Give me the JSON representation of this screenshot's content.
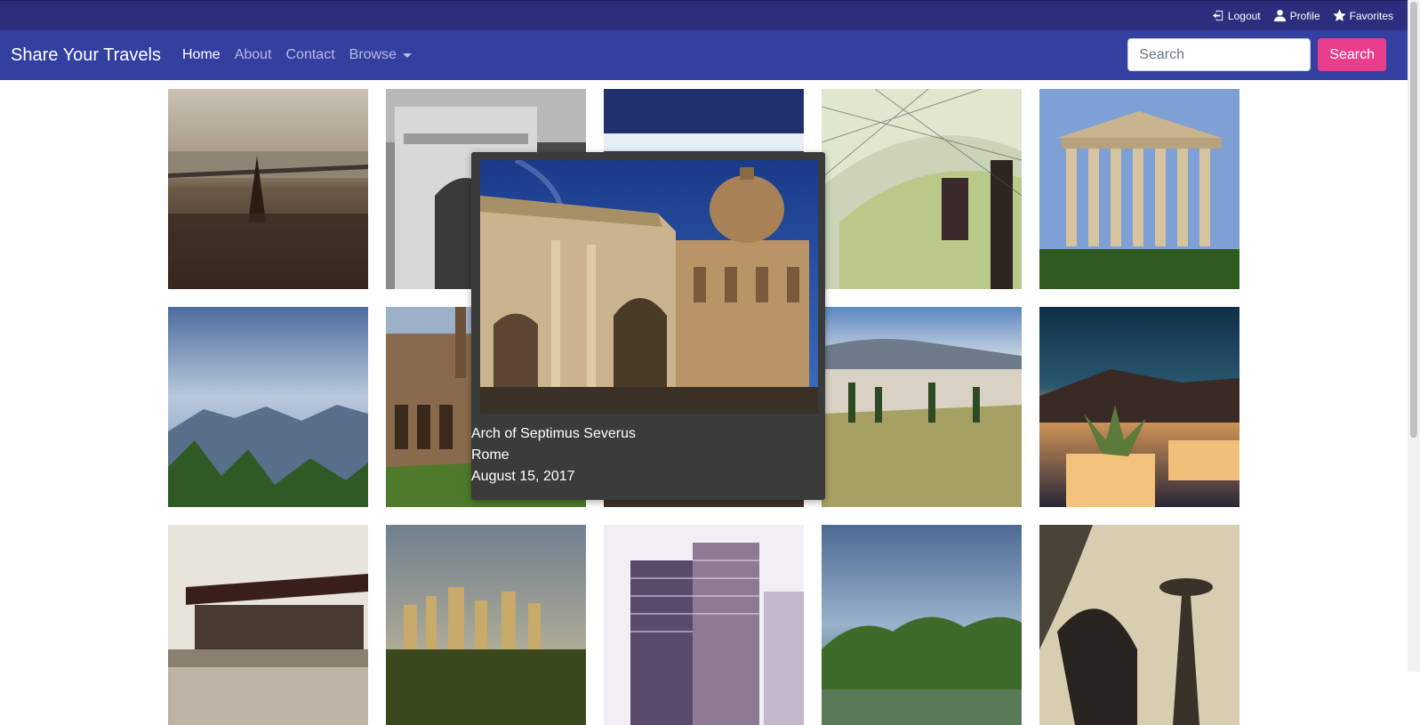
{
  "topbar": {
    "logout_label": "Logout",
    "profile_label": "Profile",
    "favorites_label": "Favorites"
  },
  "navbar": {
    "brand": "Share Your Travels",
    "links": [
      "Home",
      "About",
      "Contact",
      "Browse"
    ]
  },
  "search": {
    "placeholder": "Search",
    "button_label": "Search"
  },
  "popup": {
    "title": "Arch of Septimus Severus",
    "city": "Rome",
    "date": "August 15, 2017"
  },
  "colors": {
    "topbar": "#2b2e7c",
    "navbar": "#3340a0",
    "search_button": "#e83e8c",
    "popup_bg": "#3b3b3b"
  }
}
